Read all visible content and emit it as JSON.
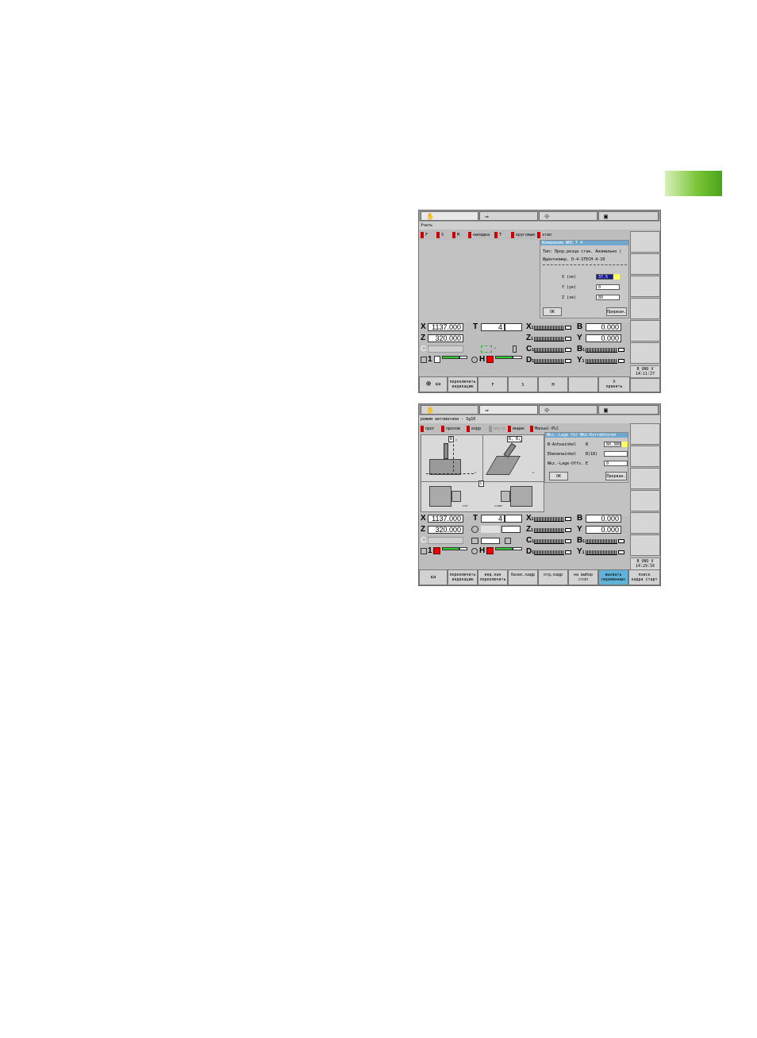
{
  "screen1": {
    "tabs": [
      "",
      "",
      "",
      ""
    ],
    "mode_title": "Учать",
    "icons": [
      "F",
      "S",
      "M",
      "наладка",
      "T",
      "круговые",
      "этап"
    ],
    "dialog": {
      "title": "Измерение WHC Т 4",
      "line1": "Тип: Прор.резца стан.  Аномально  (",
      "line2": "Идентномер. D-4-STECH-4-10",
      "rows": [
        {
          "label": "X (xe)",
          "value": "37.5"
        },
        {
          "label": "Y (ye)",
          "value": "0"
        },
        {
          "label": "Z (ze)",
          "value": "80"
        }
      ],
      "ok": "OK",
      "cancel": "Прерван."
    },
    "pos": {
      "X": "1137.000",
      "Z": "320.000",
      "T": "4",
      "B": "0.000",
      "Y": "0.000"
    },
    "spindle_no": "1",
    "info": [
      "B_UNO_V",
      "14:11:27"
    ],
    "softkeys": [
      "",
      "переключить\nиндикацию",
      "F",
      "S",
      "M",
      "",
      "X\nпринять"
    ]
  },
  "screen2": {
    "tabs": [
      "",
      "",
      "",
      ""
    ],
    "mode_title": "режим автоматики - Sg10",
    "icons": [
      "прог",
      "прохов",
      "корр",
      "инстр",
      "индик",
      "Manual-PLC"
    ],
    "dialog": {
      "title": "Wkz.-Lage für Wkz-Korrekturen",
      "rows": [
        {
          "label": "B-Achswinkel",
          "code": "B",
          "value": "80.380"
        },
        {
          "label": "Ebenenwinkel",
          "code": "B(18)",
          "value": ""
        },
        {
          "label": "Wkz.-Lage-Offs.",
          "code": "E",
          "value": "0"
        }
      ],
      "ok": "OK",
      "cancel": "Прерван."
    },
    "graphic": {
      "b_label": "B",
      "bb_label": "B, B₁",
      "c_label": "C",
      "x": "X",
      "z": "Z",
      "c0": "C=0°",
      "c180": "C=180°",
      "b_txt": "B"
    },
    "pos": {
      "X": "1137.000",
      "Z": "320.000",
      "T": "4",
      "B": "0.000",
      "Y": "0.000"
    },
    "spindle_no": "1",
    "info": [
      "B_UNO_V",
      "14:29:16"
    ],
    "softkeys": [
      "",
      "переключить\nиндикацию",
      "инд.кан\nпереключить",
      "базис.кадр",
      "отд.кадр",
      "на выбор\nстоп",
      "вызвать\nпеременных",
      "поиск\nкадра старт"
    ]
  },
  "colors": {
    "accent_tab": "#7cc63a",
    "dialog_title": "#6fa8cc",
    "active_softkey": "#5fb3d9"
  }
}
